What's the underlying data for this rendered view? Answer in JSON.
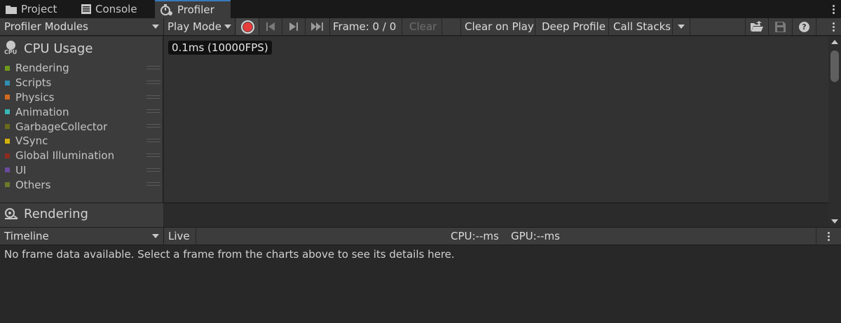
{
  "window_tabs": [
    {
      "label": "Project",
      "icon": "folder-icon"
    },
    {
      "label": "Console",
      "icon": "console-icon"
    },
    {
      "label": "Profiler",
      "icon": "stopwatch-icon",
      "active": true
    }
  ],
  "toolbar": {
    "modules_dropdown": "Profiler Modules",
    "play_mode_dropdown": "Play Mode",
    "frame_label": "Frame: 0 / 0",
    "clear_label": "Clear",
    "clear_on_play_label": "Clear on Play",
    "deep_profile_label": "Deep Profile",
    "call_stacks_label": "Call Stacks"
  },
  "modules": {
    "cpu": {
      "title": "CPU Usage",
      "icon_caption": "CPU",
      "legend": [
        {
          "label": "Rendering",
          "color": "#6f9a1b"
        },
        {
          "label": "Scripts",
          "color": "#2f8fb4"
        },
        {
          "label": "Physics",
          "color": "#d2691e"
        },
        {
          "label": "Animation",
          "color": "#38b6b6"
        },
        {
          "label": "GarbageCollector",
          "color": "#6b6b1b"
        },
        {
          "label": "VSync",
          "color": "#d4b20c"
        },
        {
          "label": "Global Illumination",
          "color": "#8f2a1e"
        },
        {
          "label": "UI",
          "color": "#6a4a9e"
        },
        {
          "label": "Others",
          "color": "#6a7a2a"
        }
      ]
    },
    "rendering": {
      "title": "Rendering"
    }
  },
  "chart": {
    "frame_time_label": "0.1ms (10000FPS)"
  },
  "details": {
    "view_dropdown": "Timeline",
    "live_label": "Live",
    "cpu_label": "CPU:--ms",
    "gpu_label": "GPU:--ms",
    "empty_message": "No frame data available. Select a frame from the charts above to see its details here."
  },
  "colors": {
    "accent": "#3a79bb",
    "record": "#e63c3c"
  }
}
